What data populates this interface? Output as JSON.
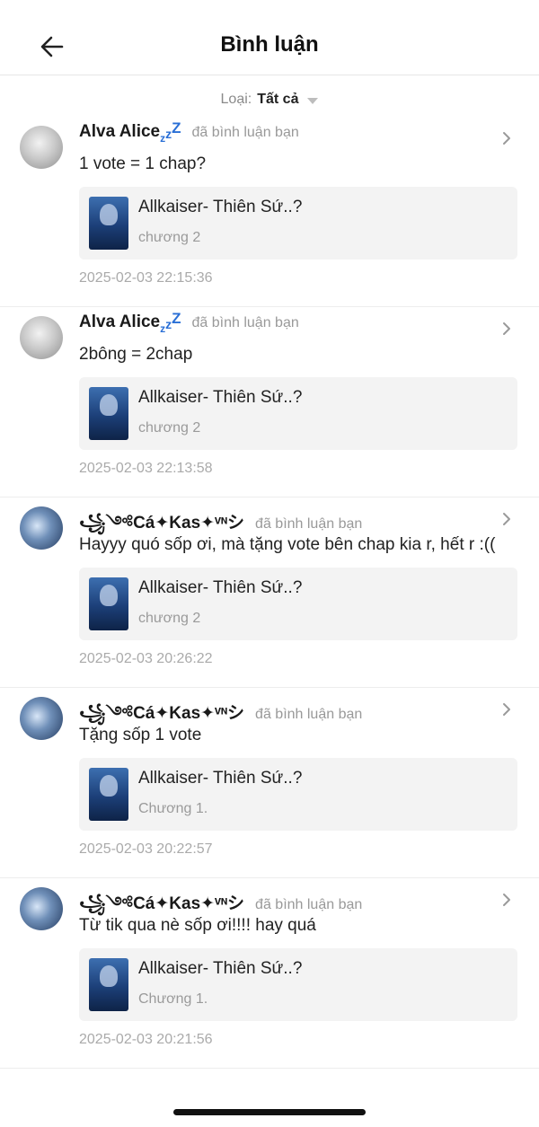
{
  "header": {
    "title": "Bình luận"
  },
  "filter": {
    "label": "Loại:",
    "value": "Tất cả"
  },
  "comments": [
    {
      "author": "Alva Alice",
      "zzz": true,
      "action": "đã bình luận bạn",
      "text": "1 vote = 1 chap?",
      "manga": "Allkaiser- Thiên Sứ..?",
      "chapter": "chương 2",
      "time": "2025-02-03 22:15:36"
    },
    {
      "author": "Alva Alice",
      "zzz": true,
      "action": "đã bình luận bạn",
      "text": "2bông = 2chap",
      "manga": "Allkaiser- Thiên Sứ..?",
      "chapter": "chương 2",
      "time": "2025-02-03 22:13:58"
    },
    {
      "author": "꧁༺Cá✦Kas✦ᵛᶰシ",
      "zzz": false,
      "action": "đã bình luận bạn",
      "text": "Hayyy quó sốp ơi, mà tặng vote bên chap kia r, hết r :((",
      "manga": "Allkaiser- Thiên Sứ..?",
      "chapter": "chương 2",
      "time": "2025-02-03 20:26:22"
    },
    {
      "author": "꧁༺Cá✦Kas✦ᵛᶰシ",
      "zzz": false,
      "action": "đã bình luận bạn",
      "text": "Tặng sốp 1 vote",
      "manga": "Allkaiser- Thiên Sứ..?",
      "chapter": "Chương 1.",
      "time": "2025-02-03 20:22:57"
    },
    {
      "author": "꧁༺Cá✦Kas✦ᵛᶰシ",
      "zzz": false,
      "action": "đã bình luận bạn",
      "text": "Từ tik qua nè sốp ơi!!!! hay quá",
      "manga": "Allkaiser- Thiên Sứ..?",
      "chapter": "Chương 1.",
      "time": "2025-02-03 20:21:56"
    }
  ],
  "icons": {
    "back": "arrow-left-icon",
    "caret": "triangle-down-icon",
    "chevron": "chevron-right-icon"
  },
  "colors": {
    "accent": "#2a6fd6",
    "muted": "#999999",
    "card_bg": "#f3f3f3"
  }
}
